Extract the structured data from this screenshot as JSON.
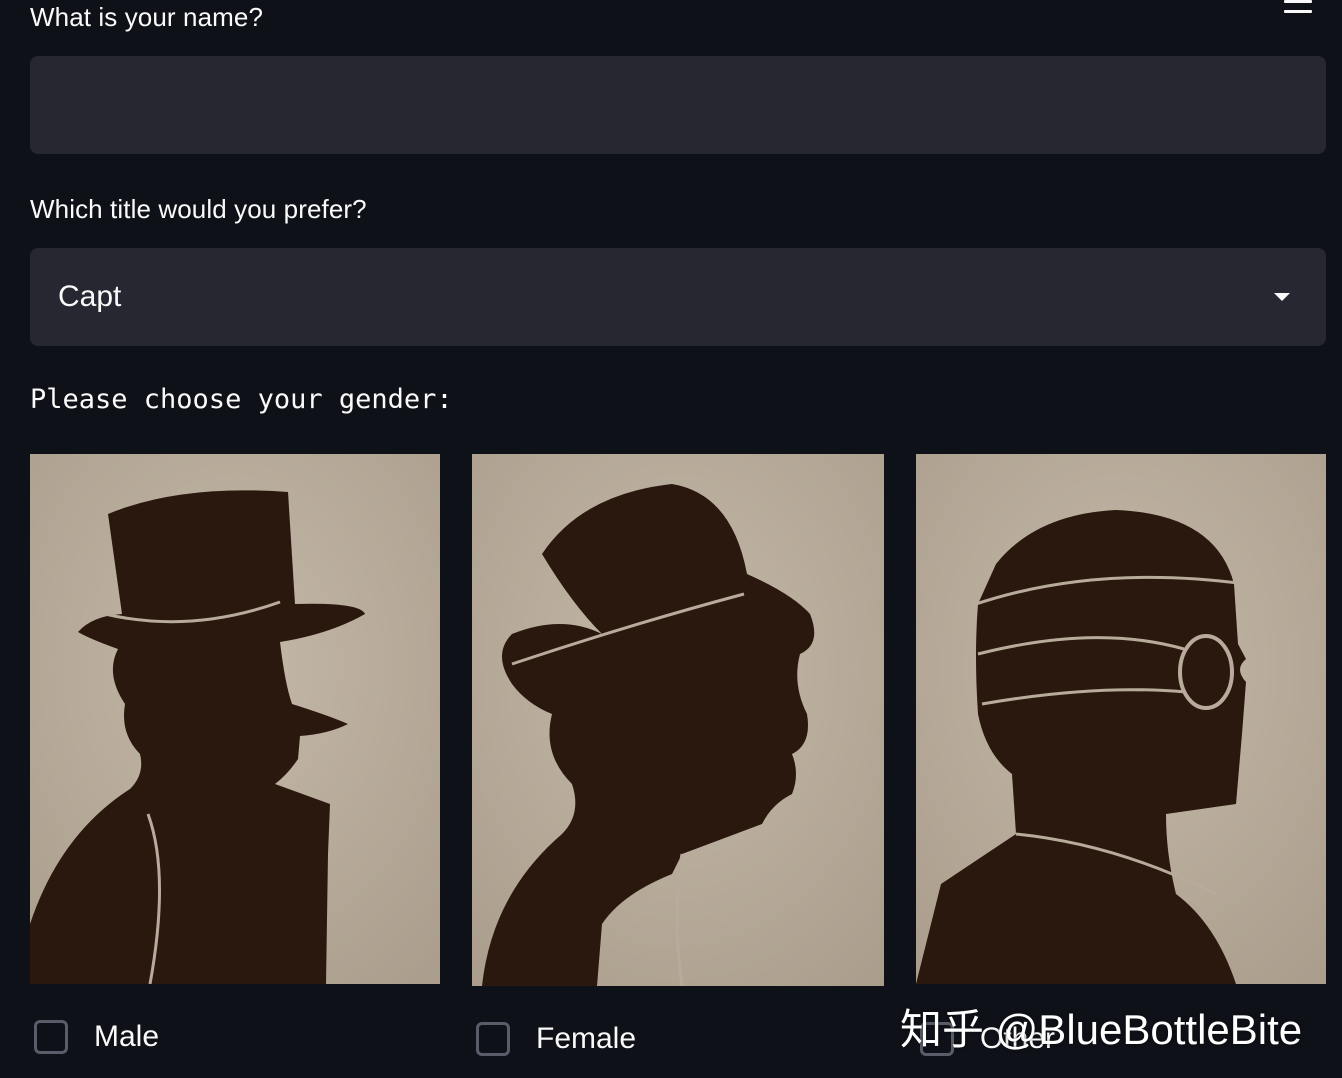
{
  "form": {
    "name_label": "What is your name?",
    "name_value": "",
    "title_label": "Which title would you prefer?",
    "title_selected": "Capt",
    "gender_prompt": "Please choose your gender:"
  },
  "genders": [
    {
      "label": "Male",
      "checked": false
    },
    {
      "label": "Female",
      "checked": false
    },
    {
      "label": "Other",
      "checked": false
    }
  ],
  "watermark": "知乎 @BlueBottleBite",
  "icons": {
    "menu": "hamburger-menu-icon",
    "select_arrow": "caret-down-icon",
    "checkbox": "checkbox-unchecked-icon"
  },
  "colors": {
    "background": "#0e1117",
    "input_bg": "#262730",
    "text": "#fafafa",
    "checkbox_border": "#5a5d69",
    "silhouette": "#2a180e",
    "card_bg": "#b8ab9b"
  }
}
